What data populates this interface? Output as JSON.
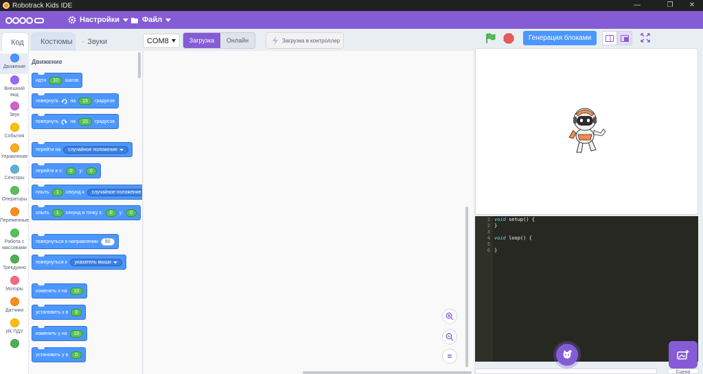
{
  "window": {
    "title": "Robotrack Kids IDE",
    "minimize": "—",
    "maximize": "❐",
    "close": "✕"
  },
  "menubar": {
    "logo": "ROBOTRACK",
    "settings_label": "Настройки",
    "file_label": "Файл"
  },
  "tabs": [
    {
      "label": "Код",
      "icon": "code-icon",
      "active": true
    },
    {
      "label": "Костюмы",
      "icon": "brush-icon",
      "active": false
    },
    {
      "label": "Звуки",
      "icon": "speaker-icon",
      "active": false
    }
  ],
  "toolbar": {
    "port": "COM8",
    "mode_upload": "Загрузка",
    "mode_online": "Онлайн",
    "upload_controller": "Загрузка в контроллер"
  },
  "categories": [
    {
      "label": "Движение",
      "color": "#4c97ff"
    },
    {
      "label": "Внешний вид",
      "color": "#9966ff"
    },
    {
      "label": "Звук",
      "color": "#cf63cf"
    },
    {
      "label": "События",
      "color": "#ffbf00"
    },
    {
      "label": "Управление",
      "color": "#ffab19"
    },
    {
      "label": "Сенсоры",
      "color": "#5cb1d6"
    },
    {
      "label": "Операторы",
      "color": "#59c059"
    },
    {
      "label": "Переменные",
      "color": "#ff8c1a"
    },
    {
      "label": "Работа с массивами",
      "color": "#59c059"
    },
    {
      "label": "Трекдуино",
      "color": "#4caf50"
    },
    {
      "label": "Моторы",
      "color": "#ff6680"
    },
    {
      "label": "Датчики",
      "color": "#ff8c1a"
    },
    {
      "label": "ИК ПДУ",
      "color": "#ffbf00"
    },
    {
      "label": "",
      "color": "#4caf50"
    }
  ],
  "palette": {
    "title": "Движение",
    "blocks": {
      "go": {
        "a": "идти",
        "v": "10",
        "b": "шагов"
      },
      "turn_right": {
        "a": "повернуть",
        "b": "на",
        "v": "15",
        "c": "градусов"
      },
      "turn_left": {
        "a": "повернуть",
        "b": "на",
        "v": "15",
        "c": "градусов"
      },
      "goto": {
        "a": "перейти на",
        "dd": "случайное положение"
      },
      "goto_xy": {
        "a": "перейти в x:",
        "x": "0",
        "b": "y:",
        "y": "0"
      },
      "glide": {
        "a": "плыть",
        "v": "1",
        "b": "секунд к",
        "dd": "случайное положение"
      },
      "glide_xy": {
        "a": "плыть",
        "v": "1",
        "b": "секунд в точку x:",
        "x": "0",
        "c": "y:",
        "y": "0"
      },
      "point_dir": {
        "a": "повернуться в направлении",
        "v": "90"
      },
      "point_towards": {
        "a": "повернуться к",
        "dd": "указатель мыши"
      },
      "change_x": {
        "a": "изменить х на",
        "v": "10"
      },
      "set_x": {
        "a": "установить х в",
        "v": "0"
      },
      "change_y": {
        "a": "изменить у на",
        "v": "10"
      },
      "set_y": {
        "a": "установить у в",
        "v": "0"
      }
    }
  },
  "stage": {
    "generate_label": "Генерация блоками"
  },
  "code": {
    "lines": [
      {
        "n": "1",
        "kw": "void",
        "rest": " setup() {"
      },
      {
        "n": "2",
        "kw": "",
        "rest": "}"
      },
      {
        "n": "3",
        "kw": "",
        "rest": ""
      },
      {
        "n": "4",
        "kw": "void",
        "rest": " loop() {"
      },
      {
        "n": "5",
        "kw": "",
        "rest": ""
      },
      {
        "n": "6",
        "kw": "",
        "rest": "}"
      }
    ]
  },
  "scene_label": "Сцена",
  "colors": {
    "accent": "#855cd6",
    "motion": "#4c97ff",
    "number": "#59c059"
  }
}
